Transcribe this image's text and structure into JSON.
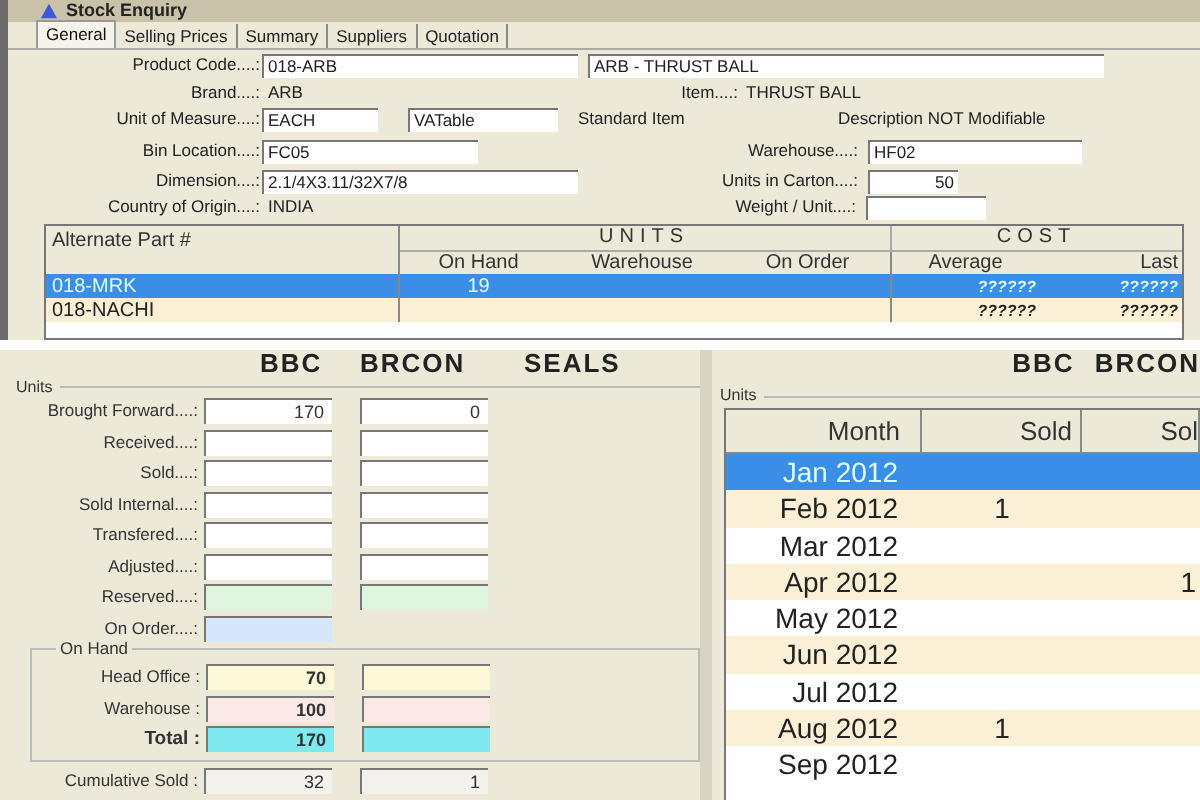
{
  "window": {
    "title": "Stock Enquiry"
  },
  "tabs": [
    {
      "label": "General",
      "selected": true
    },
    {
      "label": "Selling Prices",
      "selected": false
    },
    {
      "label": "Summary",
      "selected": false
    },
    {
      "label": "Suppliers",
      "selected": false
    },
    {
      "label": "Quotation",
      "selected": false
    }
  ],
  "general": {
    "fields": [
      {
        "label": "Product Code....:",
        "kind": "field",
        "value": "018-ARB"
      },
      {
        "kind": "field",
        "value": "ARB - THRUST BALL"
      },
      {
        "label": "Brand....:",
        "kind": "text",
        "value": "ARB"
      },
      {
        "label": "Item....:",
        "kind": "text",
        "value": "THRUST BALL"
      },
      {
        "label": "Unit of Measure....:",
        "kind": "field",
        "value": "EACH"
      },
      {
        "kind": "field",
        "value": "VATable"
      },
      {
        "kind": "text",
        "value": "Standard Item"
      },
      {
        "kind": "text",
        "value": "Description NOT Modifiable"
      },
      {
        "label": "Bin Location....:",
        "kind": "field",
        "value": "FC05"
      },
      {
        "label": "Warehouse....:",
        "kind": "field",
        "value": "HF02"
      },
      {
        "label": "Dimension....:",
        "kind": "field",
        "value": "2.1/4X3.11/32X7/8"
      },
      {
        "label": "Units in Carton....:",
        "kind": "field",
        "value": "50"
      },
      {
        "label": "Country of Origin....:",
        "kind": "text",
        "value": "INDIA"
      },
      {
        "label": "Weight / Unit....:",
        "kind": "field"
      }
    ]
  },
  "alternate_parts": {
    "group_headers": [
      "Alternate Part #",
      "UNITS",
      "COST"
    ],
    "columns": [
      "On Hand",
      "Warehouse",
      "On Order",
      "Average",
      "Last"
    ],
    "rows": [
      {
        "part": "018-MRK",
        "cells": [
          "19",
          "",
          "",
          "??????",
          "??????"
        ],
        "selected": true
      },
      {
        "part": "018-NACHI",
        "cells": [
          "",
          "",
          "",
          "??????",
          "??????"
        ],
        "selected": false
      }
    ]
  },
  "units_panel": {
    "headers": [
      "BBC",
      "BRCON",
      "SEALS"
    ],
    "group": "Units",
    "on_hand_group": "On Hand",
    "rows": [
      {
        "kind": "plain",
        "label": "Brought Forward....:",
        "values": [
          "170",
          "0"
        ]
      },
      {
        "kind": "plain",
        "label": "Received....:"
      },
      {
        "kind": "plain",
        "label": "Sold....:"
      },
      {
        "kind": "plain",
        "label": "Sold Internal....:"
      },
      {
        "kind": "plain",
        "label": "Transfered....:"
      },
      {
        "kind": "plain",
        "label": "Adjusted....:"
      },
      {
        "kind": "reserved",
        "label": "Reserved....:"
      },
      {
        "kind": "on_order",
        "label": "On Order....:"
      },
      {
        "kind": "head_office",
        "label": "Head Office :",
        "values": [
          "70"
        ]
      },
      {
        "kind": "warehouse",
        "label": "Warehouse :",
        "values": [
          "100"
        ]
      },
      {
        "kind": "total",
        "label": "Total  :",
        "values": [
          "170"
        ]
      },
      {
        "kind": "cumulative",
        "label": "Cumulative Sold :",
        "values": [
          "32",
          "1"
        ]
      }
    ]
  },
  "monthly_panel": {
    "headers": [
      "BBC",
      "BRCON"
    ],
    "group": "Units",
    "columns": [
      "Month",
      "Sold",
      "Sol"
    ],
    "rows": [
      {
        "month": "Jan 2012",
        "selected": true
      },
      {
        "month": "Feb 2012",
        "sold": "1",
        "selected": false
      },
      {
        "month": "Mar 2012",
        "selected": false
      },
      {
        "month": "Apr 2012",
        "column_3": "1",
        "selected": false
      },
      {
        "month": "May 2012",
        "selected": false
      },
      {
        "month": "Jun 2012",
        "selected": false
      },
      {
        "month": "Jul 2012",
        "selected": false
      },
      {
        "month": "Aug 2012",
        "sold": "1",
        "selected": false
      },
      {
        "month": "Sep 2012",
        "selected": false
      }
    ]
  }
}
